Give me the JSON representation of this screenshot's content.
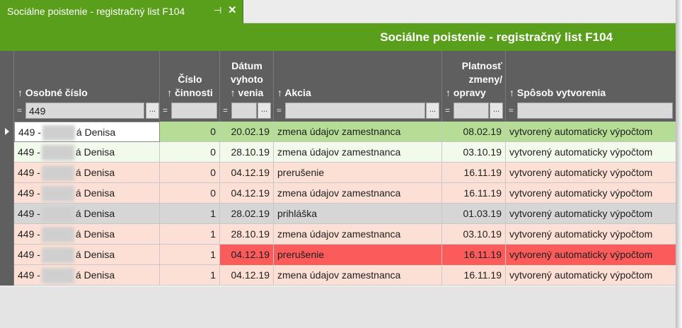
{
  "tab": {
    "title": "Sociálne poistenie - registračný list F104",
    "pin_icon": "pin-icon",
    "close_icon": "close-icon",
    "pin_glyph": "⊣",
    "close_glyph": "✕"
  },
  "header": {
    "title": "Sociálne poistenie - registračný list F104"
  },
  "colors": {
    "accent": "#5a9f1b",
    "header_bg": "#5f5f5f",
    "row_green": "#b6dd96",
    "row_light_green": "#f2faec",
    "row_salmon": "#fde0d5",
    "row_gray": "#d6d6d6",
    "row_red": "#fb5b5b"
  },
  "columns": [
    {
      "key": "osobne",
      "arrow": "↑",
      "label": "Osobné číslo",
      "filter_op": "≈",
      "filter_value": "449",
      "has_button": true
    },
    {
      "key": "cislo",
      "arrow": "↑",
      "label": "Číslo činnosti",
      "filter_op": "=",
      "filter_value": "",
      "has_button": false
    },
    {
      "key": "datum",
      "arrow": "↑",
      "label": "Dátum vyhotovenia",
      "filter_op": "=",
      "filter_value": "",
      "has_button": true
    },
    {
      "key": "akcia",
      "arrow": "↑",
      "label": "Akcia",
      "filter_op": "≈",
      "filter_value": "",
      "has_button": true
    },
    {
      "key": "platnost",
      "arrow": "↑",
      "label": "Platnosť zmeny/ opravy",
      "filter_op": "=",
      "filter_value": "",
      "has_button": true
    },
    {
      "key": "sposob",
      "arrow": "↑",
      "label": "Spôsob vytvorenia",
      "filter_op": "≈",
      "filter_value": "",
      "has_button": false
    }
  ],
  "header_labels": {
    "osobne": "Osobné číslo",
    "cislo_l1": "Číslo",
    "cislo_l2": "činnosti",
    "datum_l1": "Dátum",
    "datum_l2": "vyhoto",
    "datum_l3": "venia",
    "akcia": "Akcia",
    "platnost_l1": "Platnosť",
    "platnost_l2": "zmeny/",
    "platnost_l3": "opravy",
    "sposob": "Spôsob vytvorenia",
    "arrow": "↑",
    "op_approx": "≈",
    "op_eq": "=",
    "ellipsis": "..."
  },
  "filter": {
    "osobne_value": "449"
  },
  "rows": [
    {
      "prefix": "449 -",
      "name_suffix": "á Denisa",
      "cislo": "0",
      "datum": "20.02.19",
      "akcia": "zmena údajov zamestnanca",
      "platnost": "08.02.19",
      "sposob": "vytvorený automaticky výpočtom",
      "style": "green",
      "selected": true
    },
    {
      "prefix": "449 -",
      "name_suffix": "á Denisa",
      "cislo": "0",
      "datum": "28.10.19",
      "akcia": "zmena údajov zamestnanca",
      "platnost": "03.10.19",
      "sposob": "vytvorený automaticky výpočtom",
      "style": "light-green"
    },
    {
      "prefix": "449 -",
      "name_suffix": "á Denisa",
      "cislo": "0",
      "datum": "04.12.19",
      "akcia": "prerušenie",
      "platnost": "16.11.19",
      "sposob": "vytvorený automaticky výpočtom",
      "style": "salmon"
    },
    {
      "prefix": "449 -",
      "name_suffix": "á Denisa",
      "cislo": "0",
      "datum": "04.12.19",
      "akcia": "zmena údajov zamestnanca",
      "platnost": "16.11.19",
      "sposob": "vytvorený automaticky výpočtom",
      "style": "salmon"
    },
    {
      "prefix": "449 -",
      "name_suffix": "á Denisa",
      "cislo": "1",
      "datum": "28.02.19",
      "akcia": "prihláška",
      "platnost": "01.03.19",
      "sposob": "vytvorený automaticky výpočtom",
      "style": "gray"
    },
    {
      "prefix": "449 -",
      "name_suffix": "á Denisa",
      "cislo": "1",
      "datum": "28.10.19",
      "akcia": "zmena údajov zamestnanca",
      "platnost": "03.10.19",
      "sposob": "vytvorený automaticky výpočtom",
      "style": "salmon"
    },
    {
      "prefix": "449 -",
      "name_suffix": "á Denisa",
      "cislo": "1",
      "datum": "04.12.19",
      "akcia": "prerušenie",
      "platnost": "16.11.19",
      "sposob": "vytvorený automaticky výpočtom",
      "style": "red"
    },
    {
      "prefix": "449 -",
      "name_suffix": "á Denisa",
      "cislo": "1",
      "datum": "04.12.19",
      "akcia": "zmena údajov zamestnanca",
      "platnost": "16.11.19",
      "sposob": "vytvorený automaticky výpočtom",
      "style": "salmon"
    }
  ]
}
